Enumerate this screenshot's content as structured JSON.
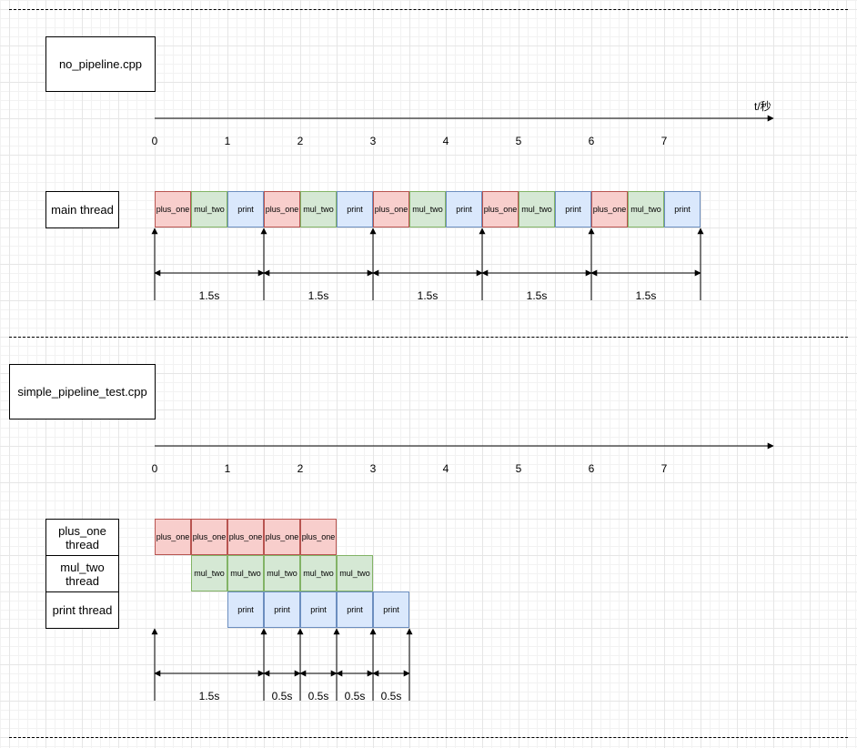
{
  "sections": [
    {
      "file": "no_pipeline.cpp",
      "axis_unit": "t/秒",
      "ticks": [
        "0",
        "1",
        "2",
        "3",
        "4",
        "5",
        "6",
        "7"
      ],
      "threads": [
        {
          "label": "main thread",
          "cells": [
            "plus_one",
            "mul_two",
            "print",
            "plus_one",
            "mul_two",
            "print",
            "plus_one",
            "mul_two",
            "print",
            "plus_one",
            "mul_two",
            "print",
            "plus_one",
            "mul_two",
            "print"
          ]
        }
      ],
      "intervals": [
        "1.5s",
        "1.5s",
        "1.5s",
        "1.5s",
        "1.5s"
      ]
    },
    {
      "file": "simple_pipeline_test.cpp",
      "ticks": [
        "0",
        "1",
        "2",
        "3",
        "4",
        "5",
        "6",
        "7"
      ],
      "threads": [
        {
          "label": "plus_one thread",
          "cells": [
            "plus_one",
            "plus_one",
            "plus_one",
            "plus_one",
            "plus_one"
          ]
        },
        {
          "label": "mul_two thread",
          "cells": [
            "mul_two",
            "mul_two",
            "mul_two",
            "mul_two",
            "mul_two"
          ]
        },
        {
          "label": "print thread",
          "cells": [
            "print",
            "print",
            "print",
            "print",
            "print"
          ]
        }
      ],
      "intervals": [
        "1.5s",
        "0.5s",
        "0.5s",
        "0.5s",
        "0.5s"
      ]
    }
  ],
  "colors": {
    "plus_one_fill": "#f8cecc",
    "plus_one_stroke": "#b85450",
    "mul_two_fill": "#d5e8d4",
    "mul_two_stroke": "#82b366",
    "print_fill": "#dae8fc",
    "print_stroke": "#6c8ebf"
  }
}
